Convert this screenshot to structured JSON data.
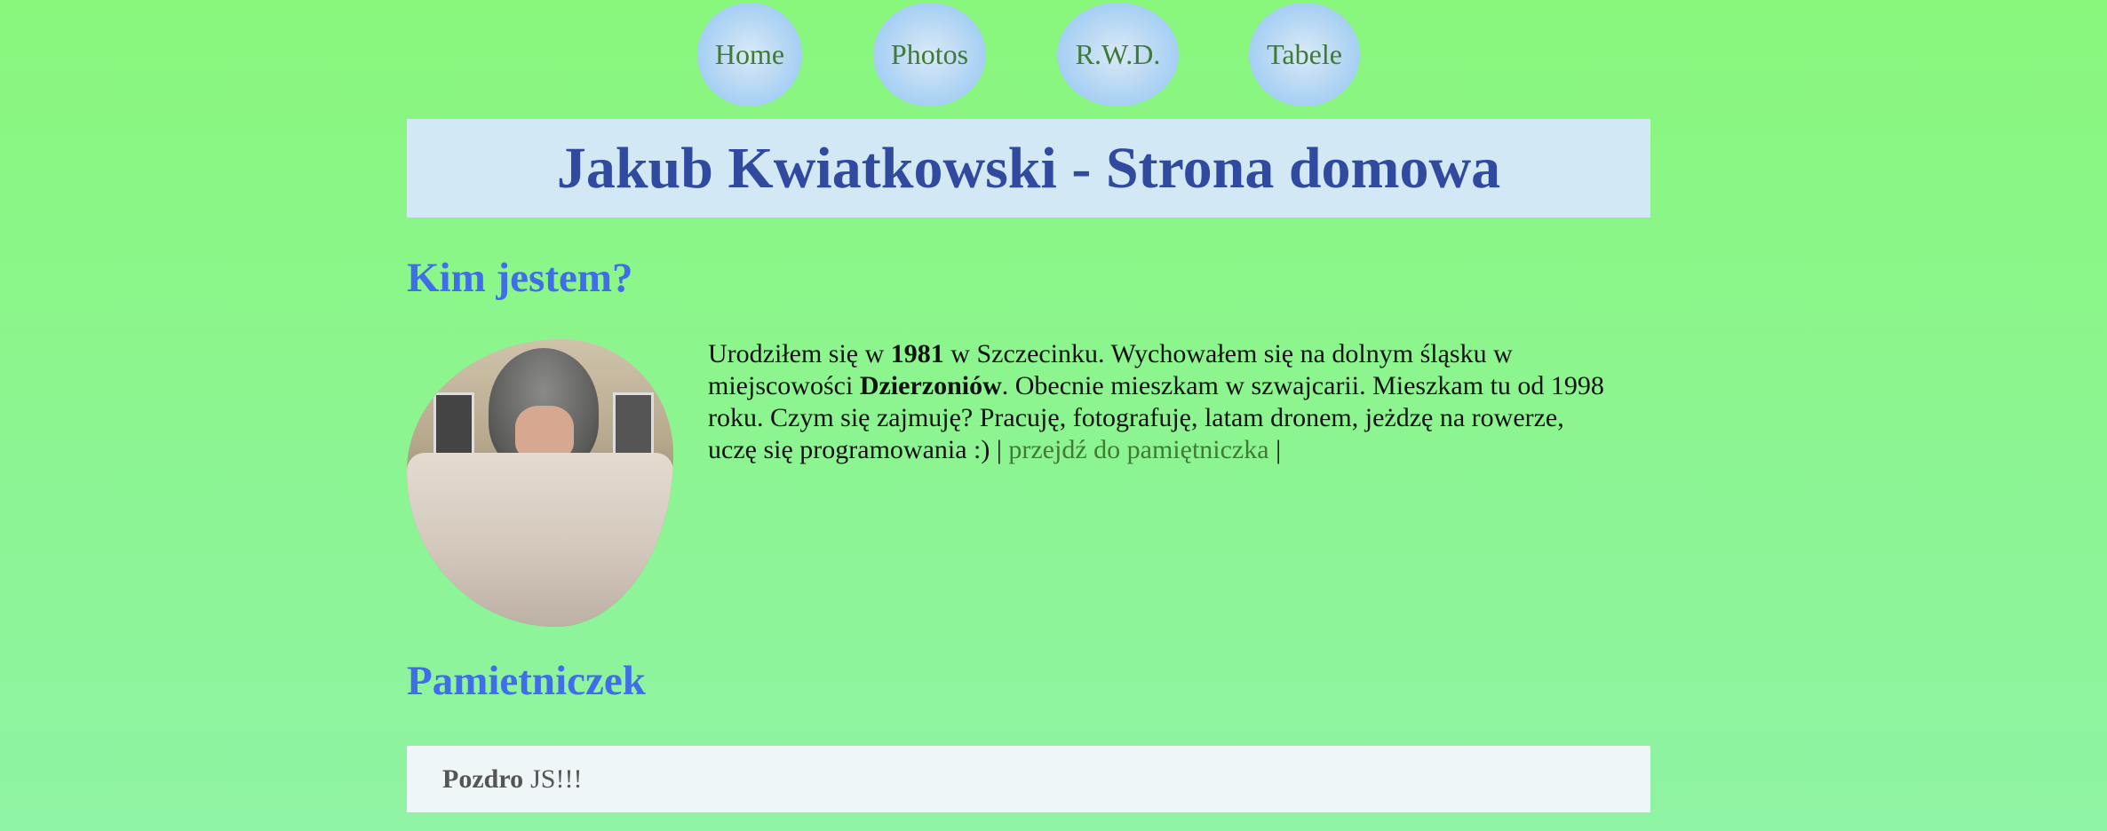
{
  "nav": {
    "items": [
      {
        "label": "Home"
      },
      {
        "label": "Photos"
      },
      {
        "label": "R.W.D."
      },
      {
        "label": "Tabele"
      }
    ]
  },
  "header": {
    "title": "Jakub Kwiatkowski - Strona domowa"
  },
  "about": {
    "heading": "Kim jestem?",
    "text_1": "Urodziłem się w ",
    "year": "1981",
    "text_2": " w Szczecinku. Wychowałem się na dolnym śląsku w miejscowości ",
    "town": "Dzierzoniów",
    "text_3": ". Obecnie mieszkam w szwajcarii. Mieszkam tu od 1998 roku. Czym się zajmuję? Pracuję, fotografuję, latam dronem, jeżdzę na rowerze, uczę się programowania :) | ",
    "link_label": "przejdź do pamiętniczka",
    "text_4": " |"
  },
  "diary": {
    "heading": "Pamietniczek",
    "entry_bold": "Pozdro",
    "entry_rest": "JS!!!"
  },
  "colors": {
    "background_top": "#89f77c",
    "background_bottom": "#8ff3a4",
    "nav_text": "#3f7a36",
    "header_bg": "#d2e8f4",
    "header_text": "#2f4a9e",
    "section_heading": "#3f6ee8",
    "diary_bg": "#eef6f7"
  }
}
